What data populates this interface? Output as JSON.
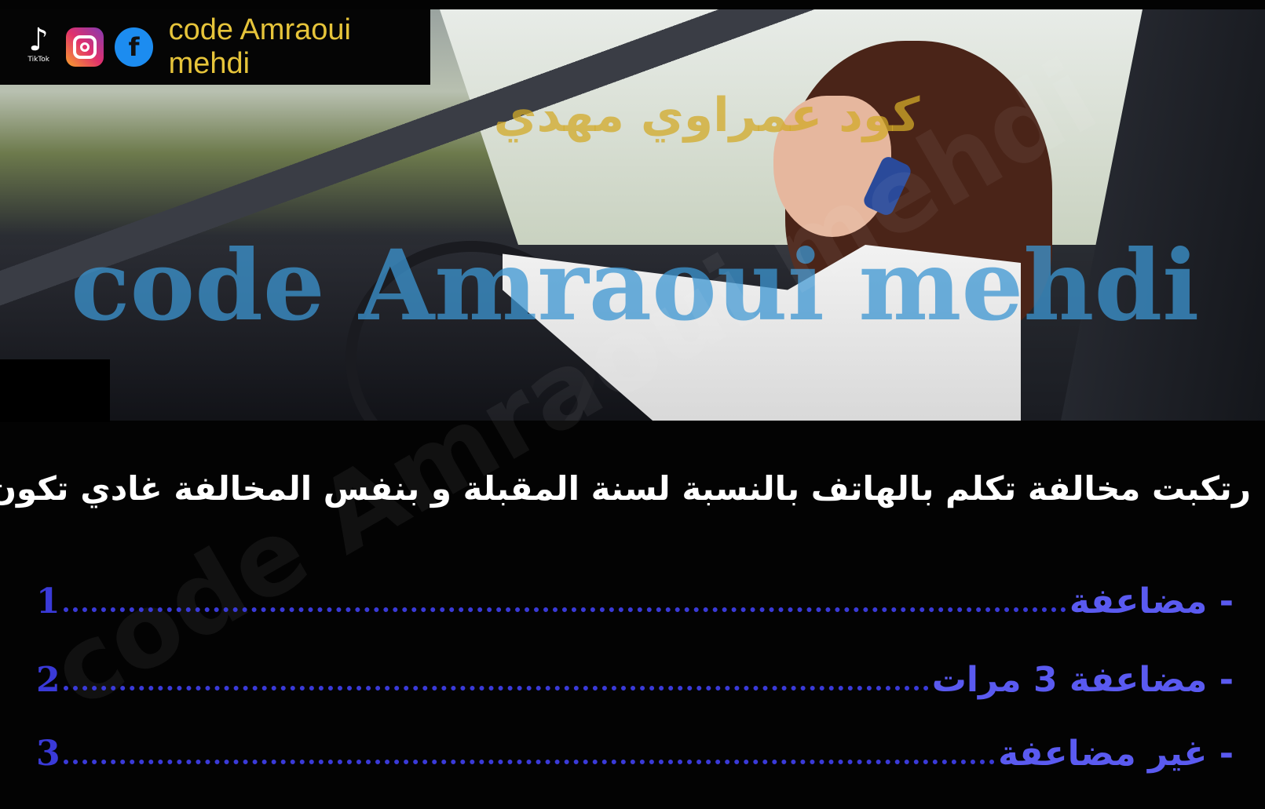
{
  "branding": {
    "name": "code Amraoui mehdi",
    "tiktok_label": "TikTok",
    "icons": [
      "tiktok-icon",
      "instagram-icon",
      "facebook-icon"
    ]
  },
  "watermarks": {
    "arabic": "كود عمراوي مهدي",
    "latin": "code Amraoui mehdi"
  },
  "question": "رتكبت مخالفة تكلم بالهاتف بالنسبة لسنة المقبلة و بنفس المخالفة غادي تكون :",
  "options": [
    {
      "number": "1",
      "text": "- مضاعفة"
    },
    {
      "number": "2",
      "text": "- مضاعفة 3 مرات"
    },
    {
      "number": "3",
      "text": "- غير مضاعفة"
    }
  ],
  "colors": {
    "brand": "#e6c43a",
    "options": "#3a3ad8",
    "question": "#ffffff"
  }
}
